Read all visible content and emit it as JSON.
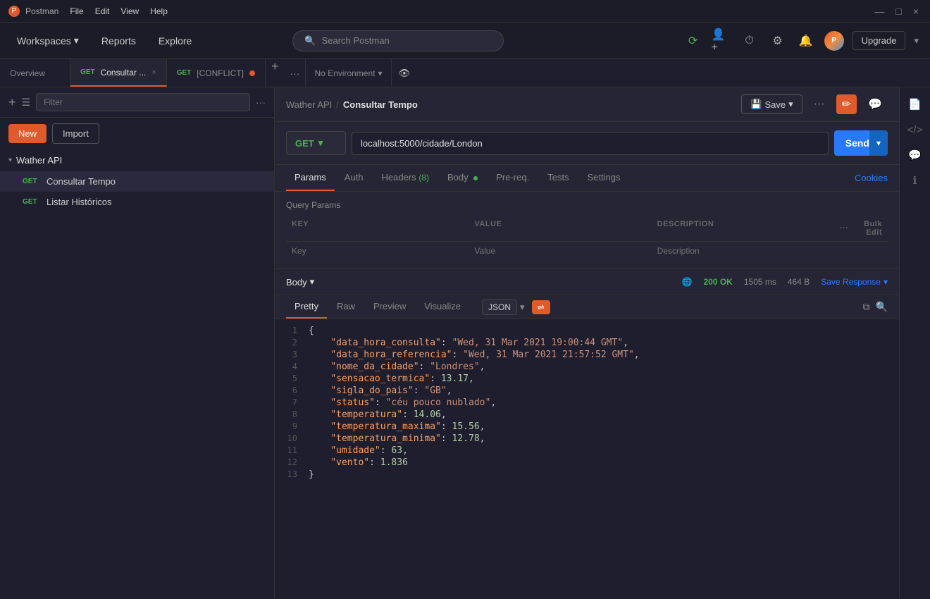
{
  "titlebar": {
    "app_name": "Postman",
    "menu_items": [
      "File",
      "Edit",
      "View",
      "Help"
    ],
    "window_controls": [
      "—",
      "□",
      "×"
    ]
  },
  "topnav": {
    "workspaces_label": "Workspaces",
    "reports_label": "Reports",
    "explore_label": "Explore",
    "search_placeholder": "Search Postman",
    "upgrade_label": "Upgrade",
    "chevron": "▾"
  },
  "tabbar": {
    "tabs": [
      {
        "id": "overview",
        "label": "Overview",
        "method": null,
        "active": false,
        "closeable": false
      },
      {
        "id": "consultar",
        "label": "Consultar ...",
        "method": "GET",
        "active": true,
        "closeable": true
      },
      {
        "id": "conflict",
        "label": "[CONFLICT]",
        "method": "GET",
        "active": false,
        "closeable": false,
        "dot": true
      }
    ],
    "add_tab": "+",
    "more_options": "···",
    "no_environment": "No Environment",
    "eye_icon": "👁"
  },
  "sidebar": {
    "new_label": "New",
    "import_label": "Import",
    "filter_placeholder": "Filter",
    "collection": {
      "name": "Wather API",
      "items": [
        {
          "method": "GET",
          "name": "Consultar Tempo",
          "active": true
        },
        {
          "method": "GET",
          "name": "Listar Históricos",
          "active": false
        }
      ]
    }
  },
  "breadcrumb": {
    "parent": "Wather API",
    "separator": "/",
    "current": "Consultar Tempo"
  },
  "toolbar": {
    "save_label": "Save",
    "save_dropdown": "▾",
    "more_options": "···",
    "edit_icon": "✏",
    "comment_icon": "💬"
  },
  "request": {
    "method": "GET",
    "method_chevron": "▾",
    "url": "localhost:5000/cidade/London",
    "send_label": "Send",
    "send_dropdown": "▾"
  },
  "request_tabs": {
    "tabs": [
      {
        "id": "params",
        "label": "Params",
        "active": true
      },
      {
        "id": "auth",
        "label": "Auth",
        "active": false
      },
      {
        "id": "headers",
        "label": "Headers",
        "badge": "(8)",
        "active": false
      },
      {
        "id": "body",
        "label": "Body",
        "dot": true,
        "active": false
      },
      {
        "id": "prereq",
        "label": "Pre-req.",
        "active": false
      },
      {
        "id": "tests",
        "label": "Tests",
        "active": false
      },
      {
        "id": "settings",
        "label": "Settings",
        "active": false
      }
    ],
    "cookies_label": "Cookies"
  },
  "query_params": {
    "title": "Query Params",
    "headers": [
      "KEY",
      "VALUE",
      "DESCRIPTION",
      "···"
    ],
    "placeholder_key": "Key",
    "placeholder_value": "Value",
    "placeholder_desc": "Description",
    "bulk_edit_label": "Bulk Edit"
  },
  "response": {
    "title": "Body",
    "title_chevron": "▾",
    "status": "200 OK",
    "time": "1505 ms",
    "size": "464 B",
    "save_response_label": "Save Response",
    "save_chevron": "▾",
    "tabs": [
      {
        "id": "pretty",
        "label": "Pretty",
        "active": true
      },
      {
        "id": "raw",
        "label": "Raw",
        "active": false
      },
      {
        "id": "preview",
        "label": "Preview",
        "active": false
      },
      {
        "id": "visualize",
        "label": "Visualize",
        "active": false
      }
    ],
    "format": "JSON",
    "format_chevron": "▾",
    "code_lines": [
      {
        "num": 1,
        "content": "{",
        "type": "brace"
      },
      {
        "num": 2,
        "key": "data_hora_consulta",
        "value": "\"Wed, 31 Mar 2021 19:00:44 GMT\"",
        "value_type": "string"
      },
      {
        "num": 3,
        "key": "data_hora_referencia",
        "value": "\"Wed, 31 Mar 2021 21:57:52 GMT\"",
        "value_type": "string"
      },
      {
        "num": 4,
        "key": "nome_da_cidade",
        "value": "\"Londres\"",
        "value_type": "string"
      },
      {
        "num": 5,
        "key": "sensacao_termica",
        "value": "13.17,",
        "value_type": "number"
      },
      {
        "num": 6,
        "key": "sigla_do_pais",
        "value": "\"GB\"",
        "value_type": "string"
      },
      {
        "num": 7,
        "key": "status",
        "value": "\"céu pouco nublado\"",
        "value_type": "string"
      },
      {
        "num": 8,
        "key": "temperatura",
        "value": "14.06,",
        "value_type": "number"
      },
      {
        "num": 9,
        "key": "temperatura_maxima",
        "value": "15.56,",
        "value_type": "number"
      },
      {
        "num": 10,
        "key": "temperatura_minima",
        "value": "12.78,",
        "value_type": "number"
      },
      {
        "num": 11,
        "key": "umidade",
        "value": "63,",
        "value_type": "number"
      },
      {
        "num": 12,
        "key": "vento",
        "value": "1.836",
        "value_type": "number"
      },
      {
        "num": 13,
        "content": "}",
        "type": "brace"
      }
    ]
  },
  "right_sidebar_icons": [
    "📄",
    "</>",
    "💬",
    "ℹ"
  ]
}
